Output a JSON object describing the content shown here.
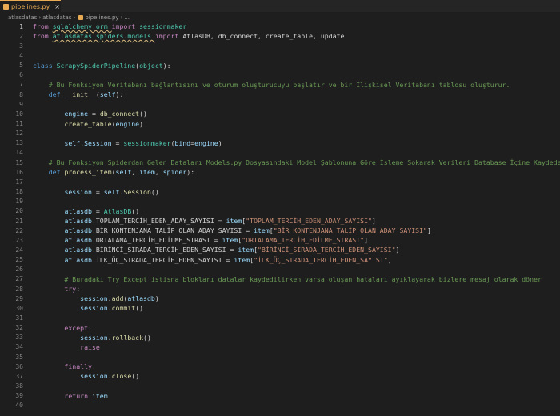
{
  "tab": {
    "label": "pipelines.py",
    "close": "×"
  },
  "breadcrumb": [
    "atlasdatas",
    "atlasdatas",
    "pipelines.py",
    "..."
  ],
  "lines": [
    [
      [
        "ctl",
        "from "
      ],
      [
        "mod",
        "sqlalchemy.orm "
      ],
      [
        "ctl",
        "import "
      ],
      [
        "cls",
        "sessionmaker"
      ]
    ],
    [
      [
        "ctl",
        "from "
      ],
      [
        "mod",
        "atlasdatas.spiders.models "
      ],
      [
        "ctl",
        "import "
      ],
      [
        "pl",
        "AtlasDB, db_connect, create_table, update"
      ]
    ],
    [],
    [],
    [
      [
        "kw",
        "class "
      ],
      [
        "cls",
        "ScrapySpiderPipeline"
      ],
      [
        "pl",
        "("
      ],
      [
        "cls",
        "object"
      ],
      [
        "pl",
        "):"
      ]
    ],
    [],
    [
      [
        "cm",
        "    # Bu Fonksiyon Veritabanı bağlantısını ve oturum oluşturucuyu başlatır ve bir İlişkisel Veritabanı tablosu oluşturur."
      ]
    ],
    [
      [
        "kw",
        "    def "
      ],
      [
        "fn",
        "__init__"
      ],
      [
        "pl",
        "("
      ],
      [
        "selfc",
        "self"
      ],
      [
        "pl",
        "):"
      ]
    ],
    [],
    [
      [
        "pl",
        "        "
      ],
      [
        "var",
        "engine"
      ],
      [
        "pl",
        " = "
      ],
      [
        "fn",
        "db_connect"
      ],
      [
        "pl",
        "()"
      ]
    ],
    [
      [
        "pl",
        "        "
      ],
      [
        "fn",
        "create_table"
      ],
      [
        "pl",
        "("
      ],
      [
        "var",
        "engine"
      ],
      [
        "pl",
        ")"
      ]
    ],
    [],
    [
      [
        "pl",
        "        "
      ],
      [
        "selfc",
        "self"
      ],
      [
        "pl",
        "."
      ],
      [
        "var",
        "Session"
      ],
      [
        "pl",
        " = "
      ],
      [
        "cls",
        "sessionmaker"
      ],
      [
        "pl",
        "("
      ],
      [
        "var",
        "bind"
      ],
      [
        "pl",
        "="
      ],
      [
        "var",
        "engine"
      ],
      [
        "pl",
        ")"
      ]
    ],
    [],
    [
      [
        "cm",
        "    # Bu Fonksiyon Spiderdan Gelen Dataları Models.py Dosyasındaki Model Şablonuna Göre İşleme Sokarak Verileri Database İçine Kaydeder"
      ]
    ],
    [
      [
        "kw",
        "    def "
      ],
      [
        "fn",
        "process_item"
      ],
      [
        "pl",
        "("
      ],
      [
        "selfc",
        "self"
      ],
      [
        "pl",
        ", "
      ],
      [
        "var",
        "item"
      ],
      [
        "pl",
        ", "
      ],
      [
        "var",
        "spider"
      ],
      [
        "pl",
        "):"
      ]
    ],
    [],
    [
      [
        "pl",
        "        "
      ],
      [
        "var",
        "session"
      ],
      [
        "pl",
        " = "
      ],
      [
        "selfc",
        "self"
      ],
      [
        "pl",
        "."
      ],
      [
        "fn",
        "Session"
      ],
      [
        "pl",
        "()"
      ]
    ],
    [],
    [
      [
        "pl",
        "        "
      ],
      [
        "var",
        "atlasdb"
      ],
      [
        "pl",
        " = "
      ],
      [
        "cls",
        "AtlasDB"
      ],
      [
        "pl",
        "()"
      ]
    ],
    [
      [
        "pl",
        "        "
      ],
      [
        "var",
        "atlasdb"
      ],
      [
        "pl",
        ".TOPLAM_TERCİH_EDEN_ADAY_SAYISI = "
      ],
      [
        "var",
        "item"
      ],
      [
        "pl",
        "["
      ],
      [
        "str",
        "\"TOPLAM_TERCİH_EDEN_ADAY_SAYISI\""
      ],
      [
        "pl",
        "]"
      ]
    ],
    [
      [
        "pl",
        "        "
      ],
      [
        "var",
        "atlasdb"
      ],
      [
        "pl",
        ".BİR_KONTENJANA_TALİP_OLAN_ADAY_SAYISI = "
      ],
      [
        "var",
        "item"
      ],
      [
        "pl",
        "["
      ],
      [
        "str",
        "\"BİR_KONTENJANA_TALİP_OLAN_ADAY_SAYISI\""
      ],
      [
        "pl",
        "]"
      ]
    ],
    [
      [
        "pl",
        "        "
      ],
      [
        "var",
        "atlasdb"
      ],
      [
        "pl",
        ".ORTALAMA_TERCİH_EDİLME_SIRASI = "
      ],
      [
        "var",
        "item"
      ],
      [
        "pl",
        "["
      ],
      [
        "str",
        "\"ORTALAMA_TERCİH_EDİLME_SIRASI\""
      ],
      [
        "pl",
        "]"
      ]
    ],
    [
      [
        "pl",
        "        "
      ],
      [
        "var",
        "atlasdb"
      ],
      [
        "pl",
        ".BİRİNCİ_SIRADA_TERCİH_EDEN_SAYISI = "
      ],
      [
        "var",
        "item"
      ],
      [
        "pl",
        "["
      ],
      [
        "str",
        "\"BİRİNCİ_SIRADA_TERCİH_EDEN_SAYISI\""
      ],
      [
        "pl",
        "]"
      ]
    ],
    [
      [
        "pl",
        "        "
      ],
      [
        "var",
        "atlasdb"
      ],
      [
        "pl",
        ".İLK_ÜÇ_SIRADA_TERCİH_EDEN_SAYISI = "
      ],
      [
        "var",
        "item"
      ],
      [
        "pl",
        "["
      ],
      [
        "str",
        "\"İLK_ÜÇ_SIRADA_TERCİH_EDEN_SAYISI\""
      ],
      [
        "pl",
        "]"
      ]
    ],
    [],
    [
      [
        "cm",
        "        # Buradaki Try Except istisna blokları datalar kaydedilirken varsa oluşan hataları ayıklayarak bizlere mesaj olarak döner"
      ]
    ],
    [
      [
        "ctl",
        "        try"
      ],
      [
        "pl",
        ":"
      ]
    ],
    [
      [
        "pl",
        "            "
      ],
      [
        "var",
        "session"
      ],
      [
        "pl",
        "."
      ],
      [
        "fn",
        "add"
      ],
      [
        "pl",
        "("
      ],
      [
        "var",
        "atlasdb"
      ],
      [
        "pl",
        ")"
      ]
    ],
    [
      [
        "pl",
        "            "
      ],
      [
        "var",
        "session"
      ],
      [
        "pl",
        "."
      ],
      [
        "fn",
        "commit"
      ],
      [
        "pl",
        "()"
      ]
    ],
    [],
    [
      [
        "ctl",
        "        except"
      ],
      [
        "pl",
        ":"
      ]
    ],
    [
      [
        "pl",
        "            "
      ],
      [
        "var",
        "session"
      ],
      [
        "pl",
        "."
      ],
      [
        "fn",
        "rollback"
      ],
      [
        "pl",
        "()"
      ]
    ],
    [
      [
        "ctl",
        "            raise"
      ]
    ],
    [],
    [
      [
        "ctl",
        "        finally"
      ],
      [
        "pl",
        ":"
      ]
    ],
    [
      [
        "pl",
        "            "
      ],
      [
        "var",
        "session"
      ],
      [
        "pl",
        "."
      ],
      [
        "fn",
        "close"
      ],
      [
        "pl",
        "()"
      ]
    ],
    [],
    [
      [
        "ctl",
        "        return "
      ],
      [
        "var",
        "item"
      ]
    ],
    []
  ]
}
